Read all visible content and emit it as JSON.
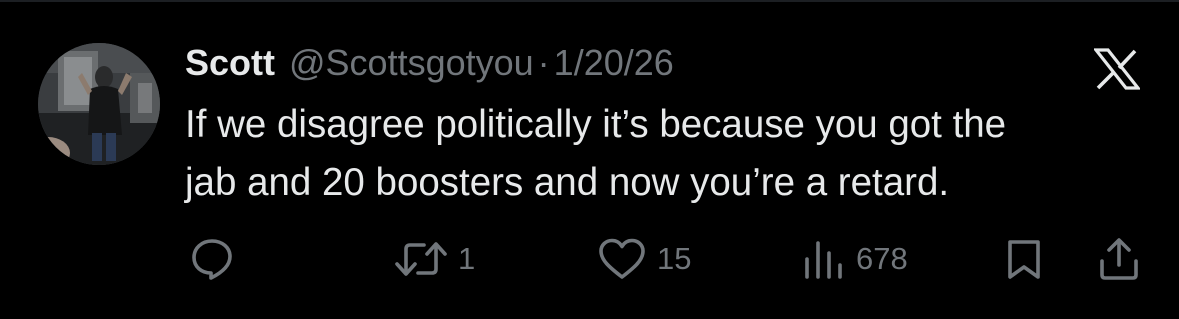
{
  "tweet": {
    "display_name": "Scott",
    "handle": "@Scottsgotyou",
    "separator": "·",
    "date": "1/20/26",
    "text": "If we disagree politically it’s because you got the\njab and 20 boosters and now you’re a retard."
  },
  "actions": {
    "reply_count": "",
    "retweet_count": "1",
    "like_count": "15",
    "views_count": "678"
  },
  "icons": {
    "brand": "x-logo-icon",
    "reply": "reply-bubble-icon",
    "retweet": "retweet-icon",
    "like": "heart-icon",
    "views": "views-bar-chart-icon",
    "bookmark": "bookmark-icon",
    "share": "share-icon"
  },
  "colors": {
    "background": "#000000",
    "primary_text": "#e7e9ea",
    "secondary_text": "#71767b"
  }
}
